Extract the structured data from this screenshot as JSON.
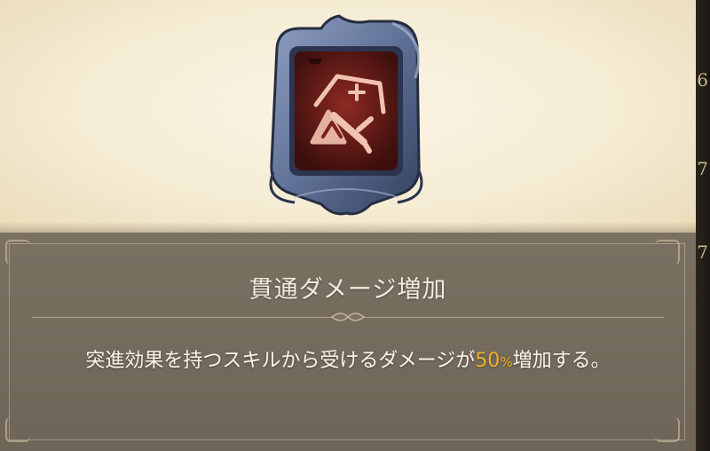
{
  "badge": {
    "icon": "piercing-sword-icon",
    "frame_color": "#5f7196",
    "inner_color": "#7a1f1a",
    "glyph_color": "#f2c2b0"
  },
  "skill": {
    "name": "貫通ダメージ増加",
    "description_prefix": "突進効果を持つスキルから受けるダメージが",
    "value": "50",
    "unit": "%",
    "description_suffix": "増加する。"
  },
  "side_numbers": [
    "6",
    "7",
    "7"
  ],
  "colors": {
    "parchment": "#f5ecd4",
    "panel": "#756c5e",
    "highlight": "#f0b02c",
    "text": "#fbf6ea"
  }
}
